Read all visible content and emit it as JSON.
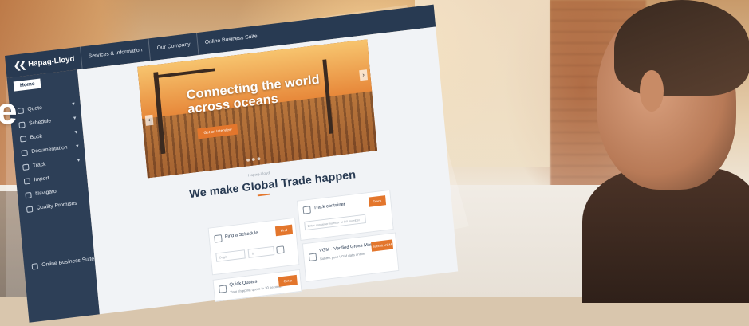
{
  "brand": {
    "logo_text": "Hapag-Lloyd",
    "accent": "#e3762c",
    "navy": "#283a52"
  },
  "hero_letter": "e",
  "top_nav": {
    "items": [
      "Services & Information",
      "Our Company",
      "Online Business Suite"
    ]
  },
  "sidebar": {
    "home_label": "Home",
    "items": [
      {
        "label": "Quote",
        "icon": "quote-icon",
        "has_chevron": true
      },
      {
        "label": "Schedule",
        "icon": "calendar-icon",
        "has_chevron": true
      },
      {
        "label": "Book",
        "icon": "book-icon",
        "has_chevron": true
      },
      {
        "label": "Documentation",
        "icon": "document-icon",
        "has_chevron": true
      },
      {
        "label": "Track",
        "icon": "track-icon",
        "has_chevron": true
      },
      {
        "label": "Import",
        "icon": "import-icon",
        "has_chevron": false
      },
      {
        "label": "Navigator",
        "icon": "navigator-icon",
        "has_chevron": false
      },
      {
        "label": "Quality Promises",
        "icon": "quality-icon",
        "has_chevron": false
      }
    ],
    "bottom_item": {
      "label": "Online Business Suite",
      "icon": "suite-icon"
    }
  },
  "hero": {
    "title_line1": "Connecting the world",
    "title_line2": "across oceans",
    "button_label": "Get an Interview"
  },
  "section": {
    "kicker": "Hapag-Lloyd",
    "headline": "We make Global Trade happen"
  },
  "cards": {
    "track": {
      "title": "Track container",
      "placeholder": "Enter container number or B/L number",
      "button": "Track"
    },
    "schedule": {
      "title": "Find a Schedule",
      "from_placeholder": "Origin",
      "to_placeholder": "To",
      "button": "Find"
    },
    "vgm": {
      "title": "VGM - Verified Gross Mass",
      "subtitle": "Submit your VGM data online",
      "button": "Submit VGM"
    },
    "quotes": {
      "title": "Quick Quotes",
      "subtitle": "Your shipping quote in 30 seconds",
      "button": "Get a Quote"
    }
  }
}
